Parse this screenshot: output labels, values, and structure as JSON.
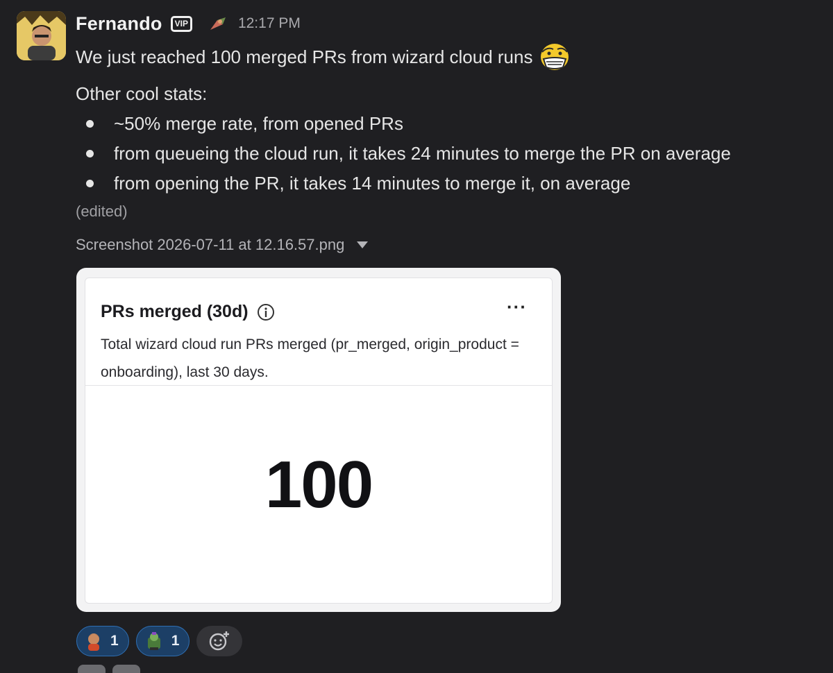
{
  "message": {
    "author": "Fernando",
    "author_badge": "VIP",
    "timestamp": "12:17 PM",
    "line1": "We just reached 100 merged PRs from wizard cloud runs",
    "line2": "Other cool stats:",
    "bullets": [
      "~50% merge rate, from opened PRs",
      "from queueing the cloud run, it takes 24 minutes to merge the PR on average",
      "from opening the PR, it takes 14 minutes to merge it, on average"
    ],
    "edited_label": "(edited)",
    "attachment_name": "Screenshot 2026-07-11 at 12.16.57.png"
  },
  "attachment_card": {
    "title": "PRs merged (30d)",
    "description": "Total wizard cloud run PRs merged (pr_merged, origin_product = onboarding), last 30 days.",
    "value": "100",
    "more_label": "···"
  },
  "reactions": [
    {
      "icon": "person-emoji-icon",
      "count": "1"
    },
    {
      "icon": "trophy-emoji-icon",
      "count": "1"
    }
  ],
  "colors": {
    "background": "#1f1f22",
    "reaction_bg": "#1c3f66",
    "reaction_border": "#2f6fb3"
  }
}
